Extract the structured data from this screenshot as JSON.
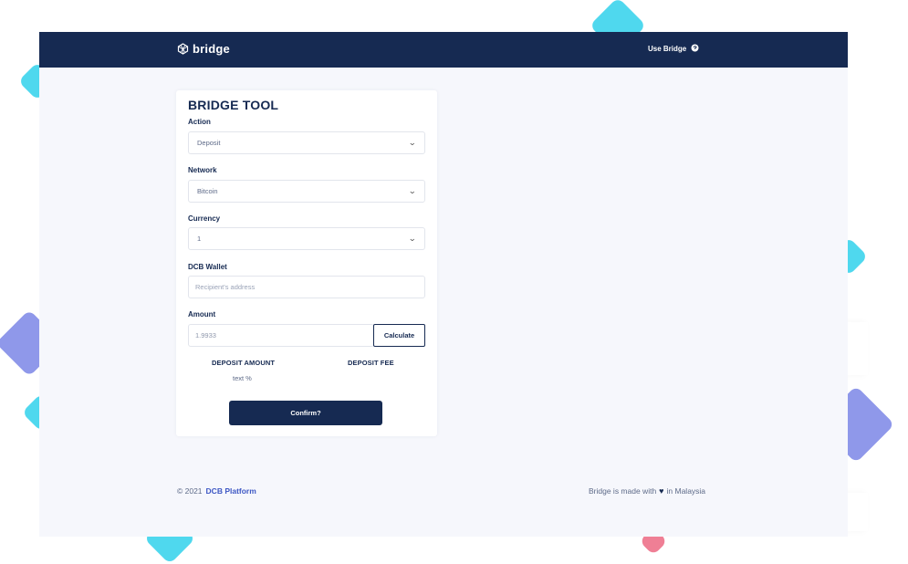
{
  "colors": {
    "navbar": "#162a52",
    "page_bg": "#f6f7fc",
    "accent_link": "#3d57c4",
    "deco_cyan": "#4fd8ee",
    "deco_purple": "#8f98ea",
    "deco_pink": "#ef7f95"
  },
  "navbar": {
    "brand": "bridge",
    "brand_icon": "bridge-logo-icon",
    "use_bridge_label": "Use Bridge",
    "use_bridge_icon": "help-circle-icon"
  },
  "form": {
    "title": "BRIDGE TOOL",
    "action": {
      "label": "Action",
      "value": "Deposit"
    },
    "network": {
      "label": "Network",
      "value": "Bitcoin"
    },
    "currency": {
      "label": "Currency",
      "value": "1"
    },
    "wallet": {
      "label": "DCB Wallet",
      "placeholder": "Recipient's address"
    },
    "amount": {
      "label": "Amount",
      "value": "1.9933"
    },
    "calculate_label": "Calculate",
    "deposit_amount": {
      "label": "DEPOSIT AMOUNT",
      "value": "text %"
    },
    "deposit_fee": {
      "label": "DEPOSIT FEE"
    },
    "confirm_label": "Confirm?"
  },
  "footer": {
    "copyright": "© 2021",
    "platform_link": "DCB Platform",
    "made_with_prefix": "Bridge is made with",
    "heart_icon": "heart-icon",
    "made_with_suffix": "in Malaysia"
  }
}
